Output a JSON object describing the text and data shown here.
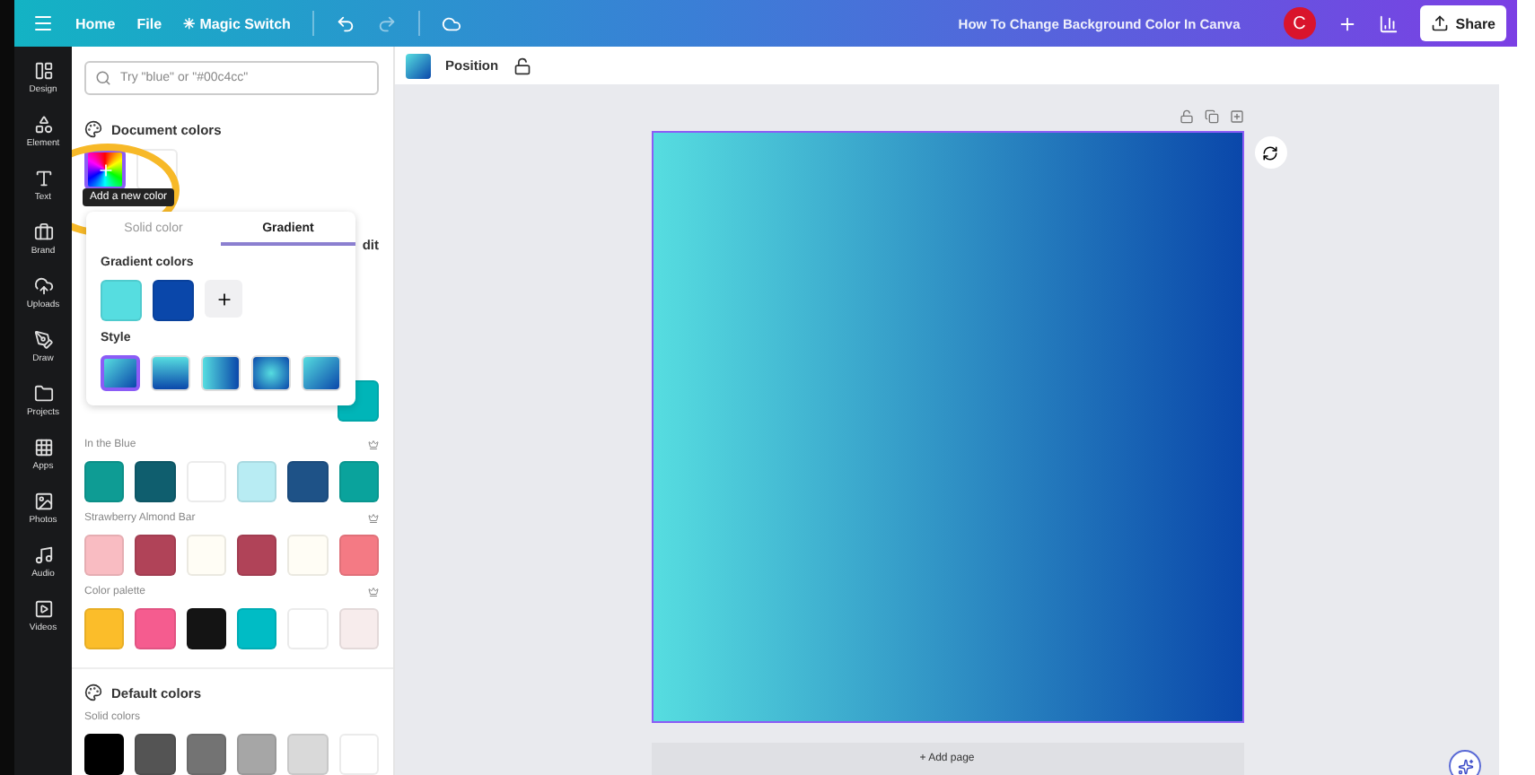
{
  "top_bar": {
    "menu": [
      "Home",
      "File"
    ],
    "magic_switch_icon": "✳",
    "magic_switch": "Magic Switch",
    "title": "How To Change Background Color In Canva",
    "avatar": "C",
    "share": "Share"
  },
  "rail": [
    {
      "label": "Design"
    },
    {
      "label": "Element"
    },
    {
      "label": "Text"
    },
    {
      "label": "Brand"
    },
    {
      "label": "Uploads"
    },
    {
      "label": "Draw"
    },
    {
      "label": "Projects"
    },
    {
      "label": "Apps"
    },
    {
      "label": "Photos"
    },
    {
      "label": "Audio"
    },
    {
      "label": "Videos"
    }
  ],
  "panel": {
    "search_placeholder": "Try \"blue\" or \"#00c4cc\"",
    "document_colors": "Document colors",
    "edit_fragment": "dit",
    "hidden_swatch": {
      "color": "#00b5b8"
    },
    "palettes": [
      {
        "name": "In the Blue",
        "colors": [
          {
            "color": "#0e9c94"
          },
          {
            "color": "#0f5e6e"
          },
          {
            "color": "#ffffff"
          },
          {
            "color": "#b8ecf3"
          },
          {
            "color": "#1e5287"
          },
          {
            "color": "#0aa39c"
          }
        ]
      },
      {
        "name": "Strawberry Almond Bar",
        "colors": [
          {
            "color": "#f9bcc2"
          },
          {
            "color": "#b04358"
          },
          {
            "color": "#fffdf5"
          },
          {
            "color": "#b04358"
          },
          {
            "color": "#fffdf5"
          },
          {
            "color": "#f47a84"
          }
        ]
      },
      {
        "name": "Color palette",
        "colors": [
          {
            "color": "#fbbd2a"
          },
          {
            "color": "#f55c8f"
          },
          {
            "color": "#141414"
          },
          {
            "color": "#00bcc5"
          },
          {
            "color": "#ffffff"
          },
          {
            "color": "#f7ecec"
          }
        ]
      }
    ],
    "default_colors": "Default colors",
    "solid_colors": "Solid colors",
    "solid": [
      {
        "color": "#000000"
      },
      {
        "color": "#545454"
      },
      {
        "color": "#737373"
      },
      {
        "color": "#a6a6a6"
      },
      {
        "color": "#d9d9d9"
      },
      {
        "color": "#ffffff"
      }
    ]
  },
  "tooltip": "Add a new color",
  "popover": {
    "tabs": [
      {
        "label": "Solid color",
        "selected": false
      },
      {
        "label": "Gradient",
        "selected": true
      }
    ],
    "gradient_colors_label": "Gradient colors",
    "gradient_colors": [
      {
        "color": "#56dde0"
      },
      {
        "color": "#0a47aa"
      }
    ],
    "style_label": "Style",
    "styles": [
      {
        "kind": "diagonal",
        "selected": true
      },
      {
        "kind": "vertical",
        "selected": false
      },
      {
        "kind": "horizontal",
        "selected": false
      },
      {
        "kind": "radial",
        "selected": false
      },
      {
        "kind": "diagonal",
        "selected": false
      }
    ]
  },
  "toolbar": {
    "position": "Position"
  },
  "add_page": "+ Add page"
}
